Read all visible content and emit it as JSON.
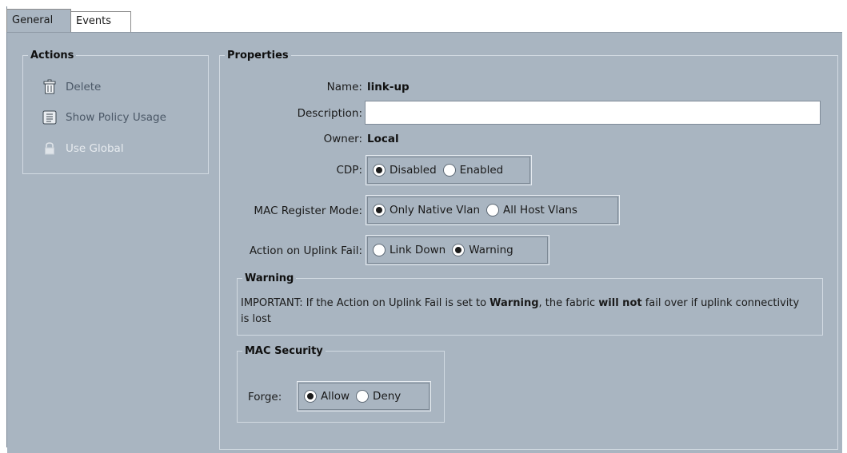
{
  "tabs": [
    {
      "label": "General",
      "active": true
    },
    {
      "label": "Events",
      "active": false
    }
  ],
  "actions": {
    "title": "Actions",
    "items": [
      {
        "label": "Delete",
        "icon": "trash-icon",
        "enabled": true
      },
      {
        "label": "Show Policy Usage",
        "icon": "scroll-icon",
        "enabled": true
      },
      {
        "label": "Use Global",
        "icon": "lock-icon",
        "enabled": false
      }
    ]
  },
  "properties": {
    "title": "Properties",
    "name_label": "Name:",
    "name_value": "link-up",
    "description_label": "Description:",
    "description_value": "",
    "owner_label": "Owner:",
    "owner_value": "Local",
    "cdp": {
      "label": "CDP:",
      "options": [
        "Disabled",
        "Enabled"
      ],
      "selected": "Disabled"
    },
    "mac_register_mode": {
      "label": "MAC Register Mode:",
      "options": [
        "Only Native Vlan",
        "All Host Vlans"
      ],
      "selected": "Only Native Vlan"
    },
    "action_on_uplink_fail": {
      "label": "Action on Uplink Fail:",
      "options": [
        "Link Down",
        "Warning"
      ],
      "selected": "Warning"
    },
    "warning": {
      "title": "Warning",
      "text_1": "IMPORTANT: If the Action on Uplink Fail is set to ",
      "bold_1": "Warning",
      "text_2": ", the fabric ",
      "bold_2": "will not",
      "text_3": " fail over if uplink connectivity is lost"
    },
    "mac_security": {
      "title": "MAC Security",
      "forge_label": "Forge:",
      "options": [
        "Allow",
        "Deny"
      ],
      "selected": "Allow"
    }
  },
  "colors": {
    "panel_bg": "#a9b5c1",
    "tab_active_bg": "#aab6c2",
    "link_text": "#4b5867",
    "disabled_text": "#e7ebef"
  }
}
